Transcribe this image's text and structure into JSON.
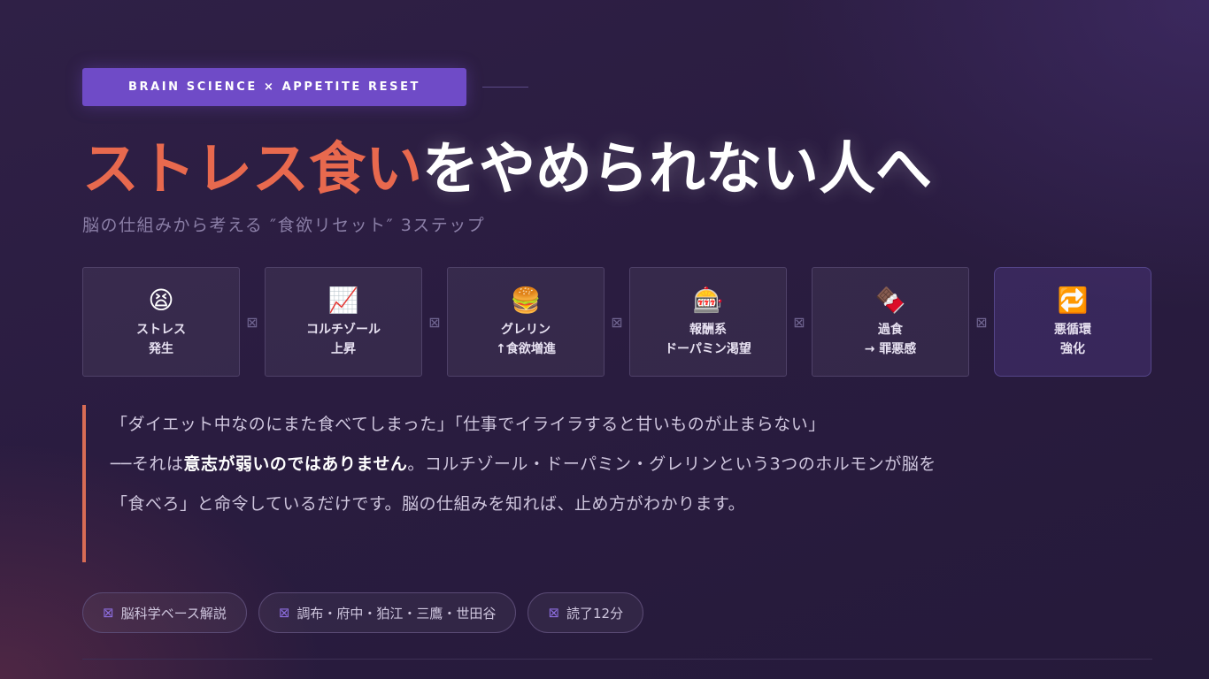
{
  "badge": {
    "label": "BRAIN SCIENCE × APPETITE RESET"
  },
  "title": {
    "accent": "ストレス食い",
    "rest": "をやめられない人へ"
  },
  "subtitle": "脳の仕組みから考える ″食欲リセット″ 3ステップ",
  "flow": {
    "arrow": "⊠",
    "steps": [
      {
        "icon": "😫",
        "icon_name": "stressed-face-icon",
        "line1": "ストレス",
        "line2": "発生"
      },
      {
        "icon": "📈",
        "icon_name": "chart-up-icon",
        "line1": "コルチゾール",
        "line2": "上昇"
      },
      {
        "icon": "🍔",
        "icon_name": "burger-icon",
        "line1": "グレリン",
        "line2": "↑食欲増進"
      },
      {
        "icon": "🎰",
        "icon_name": "slot-machine-icon",
        "line1": "報酬系",
        "line2": "ドーパミン渇望"
      },
      {
        "icon": "🍫",
        "icon_name": "chocolate-icon",
        "line1": "過食",
        "line2": "→ 罪悪感"
      },
      {
        "icon": "🔁",
        "icon_name": "repeat-icon",
        "line1": "悪循環",
        "line2": "強化"
      }
    ]
  },
  "quote": {
    "intro": "「ダイエット中なのにまた食べてしまった」「仕事でイライラすると甘いものが止まらない」",
    "dash": "──それは",
    "emphasis": "意志が弱いのではありません",
    "body": "。コルチゾール・ドーパミン・グレリンという3つのホルモンが脳を「食べろ」と命令しているだけです。脳の仕組みを知れば、止め方がわかります。"
  },
  "tags": [
    {
      "icon": "⊠",
      "label": "脳科学ベース解説"
    },
    {
      "icon": "⊠",
      "label": "調布・府中・狛江・三鷹・世田谷"
    },
    {
      "icon": "⊠",
      "label": "読了12分"
    }
  ],
  "colors": {
    "accent": "#e8694e",
    "badge": "#6f4bc7",
    "quote_border": "#d86c55"
  }
}
